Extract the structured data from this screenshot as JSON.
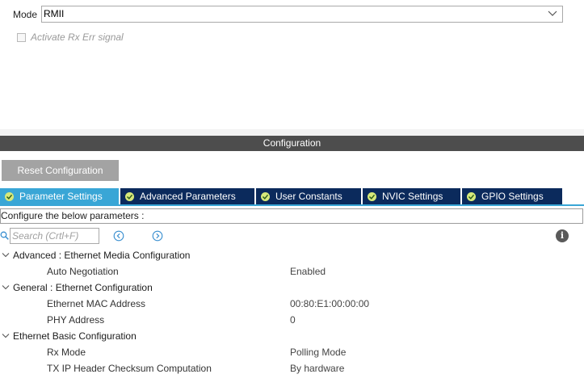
{
  "mode": {
    "label": "Mode",
    "selected": "RMII"
  },
  "rx_err": {
    "label": "Activate Rx Err signal",
    "checked": false
  },
  "configuration": {
    "title": "Configuration",
    "reset_label": "Reset Configuration"
  },
  "tabs": [
    {
      "label": "Parameter Settings",
      "active": true
    },
    {
      "label": "Advanced Parameters",
      "active": false
    },
    {
      "label": "User Constants",
      "active": false
    },
    {
      "label": "NVIC Settings",
      "active": false
    },
    {
      "label": "GPIO Settings",
      "active": false
    }
  ],
  "description": "Configure the below parameters :",
  "search": {
    "placeholder": "Search (Crtl+F)"
  },
  "groups": [
    {
      "title": "Advanced : Ethernet Media Configuration",
      "params": [
        {
          "name": "Auto Negotiation",
          "value": "Enabled"
        }
      ]
    },
    {
      "title": "General : Ethernet Configuration",
      "params": [
        {
          "name": "Ethernet MAC Address",
          "value": "00:80:E1:00:00:00"
        },
        {
          "name": "PHY Address",
          "value": "0"
        }
      ]
    },
    {
      "title": "Ethernet Basic Configuration",
      "params": [
        {
          "name": "Rx Mode",
          "value": "Polling Mode"
        },
        {
          "name": "TX IP Header Checksum Computation",
          "value": "By hardware"
        }
      ]
    }
  ],
  "colors": {
    "tab_active": "#39a6d6",
    "tab_inactive": "#0b2a5c",
    "config_bar": "#4d4d4d",
    "reset_button": "#a3a3a3",
    "tick": "#d7e97a"
  }
}
